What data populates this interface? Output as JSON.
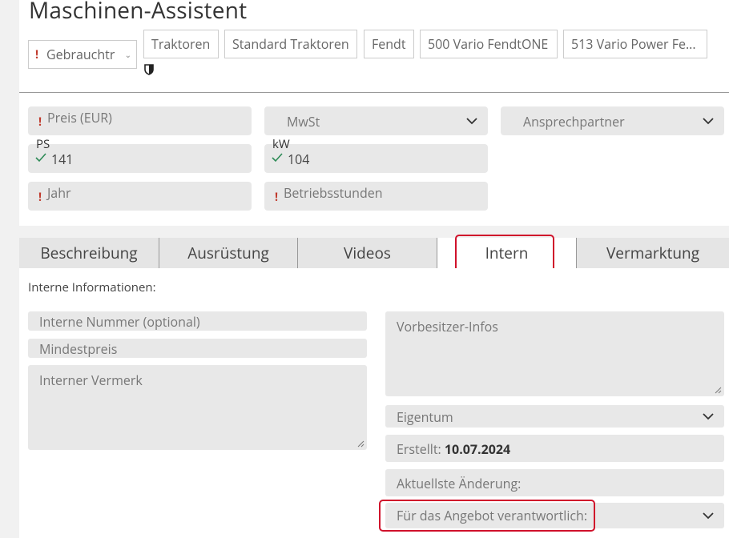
{
  "title": "Maschinen-Assistent",
  "condition_select": {
    "value": "Gebrauchtr",
    "required_mark": "!"
  },
  "breadcrumbs": [
    "Traktoren",
    "Standard Traktoren",
    "Fendt",
    "500 Vario FendtONE",
    "513 Vario Power Fe..."
  ],
  "fields": {
    "price": {
      "label": "Preis (EUR)",
      "required_mark": "!"
    },
    "vat": {
      "label": "MwSt"
    },
    "contact": {
      "label": "Ansprechpartner"
    },
    "ps": {
      "label": "PS",
      "value": "141"
    },
    "kw": {
      "label": "kW",
      "value": "104"
    },
    "year": {
      "label": "Jahr",
      "required_mark": "!"
    },
    "hours": {
      "label": "Betriebsstunden",
      "required_mark": "!"
    }
  },
  "tabs": [
    {
      "label": "Beschreibung"
    },
    {
      "label": "Ausrüstung"
    },
    {
      "label": "Videos"
    },
    {
      "label": "Intern",
      "active": true
    },
    {
      "label": "Vermarktung"
    }
  ],
  "intern": {
    "heading": "Interne Informationen:",
    "internal_number_placeholder": "Interne Nummer (optional)",
    "min_price_placeholder": "Mindestpreis",
    "internal_note_placeholder": "Interner Vermerk",
    "previous_owner_placeholder": "Vorbesitzer-Infos",
    "ownership_label": "Eigentum",
    "created_label": "Erstellt:",
    "created_value": "10.07.2024",
    "last_change_label": "Aktuellste Änderung:",
    "responsible_label": "Für das Angebot verantwortlich:"
  },
  "colors": {
    "required": "#c0392b",
    "valid": "#2e8b57",
    "highlight": "#d0112b",
    "field_bg": "#e8e8e8"
  }
}
